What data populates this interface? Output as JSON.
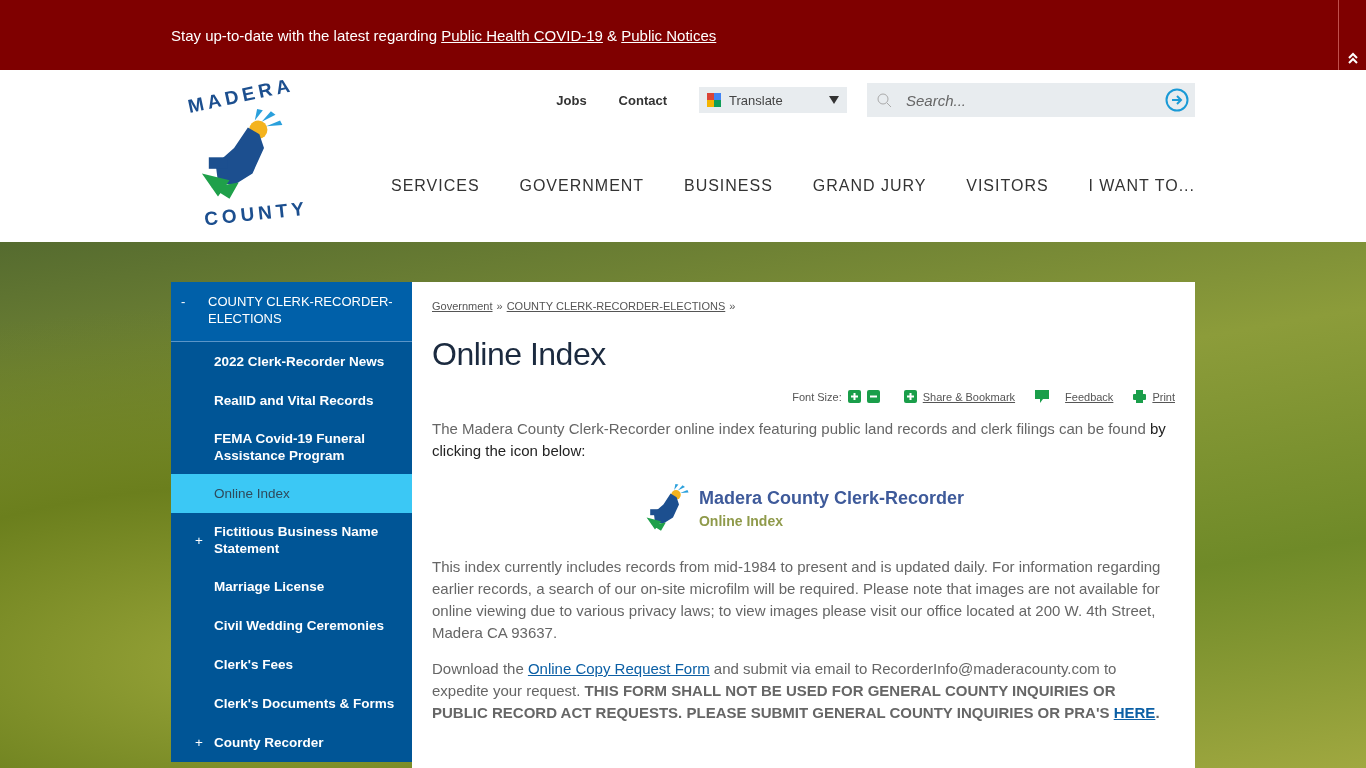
{
  "alert_bar": {
    "segments": [
      {
        "kind": "text",
        "text": "Stay up-to-date with  the latest regarding "
      },
      {
        "kind": "link",
        "text": "Public Health COVID-19"
      },
      {
        "kind": "text",
        "text": " & "
      },
      {
        "kind": "link",
        "text": "Public Notices"
      }
    ]
  },
  "logo": {
    "top": "MADERA",
    "bottom": "COUNTY"
  },
  "utility_links": [
    "Jobs",
    "Contact"
  ],
  "translate": {
    "label": "Translate"
  },
  "search": {
    "placeholder": "Search..."
  },
  "main_nav": [
    "SERVICES",
    "GOVERNMENT",
    "BUSINESS",
    "GRAND JURY",
    "VISITORS",
    "I WANT TO..."
  ],
  "sidebar": {
    "heading": {
      "toggle": "-",
      "label": "COUNTY CLERK-RECORDER-ELECTIONS"
    },
    "items": [
      {
        "label": "2022 Clerk-Recorder News",
        "selected": false
      },
      {
        "label": "RealID and Vital Records",
        "selected": false
      },
      {
        "label": "FEMA Covid-19 Funeral Assistance Program",
        "selected": false
      },
      {
        "label": "Online Index",
        "selected": true
      },
      {
        "label": "Fictitious Business Name Statement",
        "selected": false,
        "toggle": "+"
      },
      {
        "label": "Marriage License",
        "selected": false
      },
      {
        "label": "Civil Wedding Ceremonies",
        "selected": false
      },
      {
        "label": "Clerk's Fees",
        "selected": false
      },
      {
        "label": "Clerk's Documents & Forms",
        "selected": false
      },
      {
        "label": "County Recorder",
        "selected": false,
        "toggle": "+"
      }
    ]
  },
  "breadcrumb": [
    {
      "text": "Government"
    },
    {
      "text": "COUNTY CLERK-RECORDER-ELECTIONS"
    }
  ],
  "breadcrumb_separator": "»",
  "page_title": "Online Index",
  "tools": {
    "font_size_label": "Font Size:",
    "share": "Share & Bookmark",
    "feedback": "Feedback",
    "print": "Print"
  },
  "blocks": [
    {
      "kind": "paragraph",
      "segments": [
        {
          "kind": "text",
          "text": "The Madera County Clerk-Recorder online index featuring public land records and clerk filings can be found "
        },
        {
          "kind": "dark",
          "text": "by clicking the icon below:"
        }
      ]
    },
    {
      "kind": "banner"
    },
    {
      "kind": "paragraph",
      "segments": [
        {
          "kind": "text",
          "text": "This index currently includes records from mid-1984 to present and is updated daily.  For information regarding earlier records, a search of our on-site microfilm will be required.  Please note that images are not available for online viewing due to various privacy laws; to view images please visit our office located at 200 W. 4th Street, Madera CA 93637."
        }
      ]
    },
    {
      "kind": "paragraph",
      "segments": [
        {
          "kind": "text",
          "text": "Download the "
        },
        {
          "kind": "link",
          "text": "Online Copy Request Form"
        },
        {
          "kind": "text",
          "text": " and submit via email to RecorderInfo@maderacounty.com to expedite your request. "
        },
        {
          "kind": "bold",
          "text": "THIS FORM SHALL NOT BE USED FOR GENERAL COUNTY INQUIRIES OR PUBLIC RECORD ACT REQUESTS. PLEASE SUBMIT GENERAL COUNTY INQUIRIES OR PRA'S "
        },
        {
          "kind": "boldlink",
          "text": "HERE"
        },
        {
          "kind": "bold",
          "text": "."
        }
      ]
    }
  ],
  "banner": {
    "title": "Madera County Clerk-Recorder",
    "subtitle": "Online Index"
  }
}
